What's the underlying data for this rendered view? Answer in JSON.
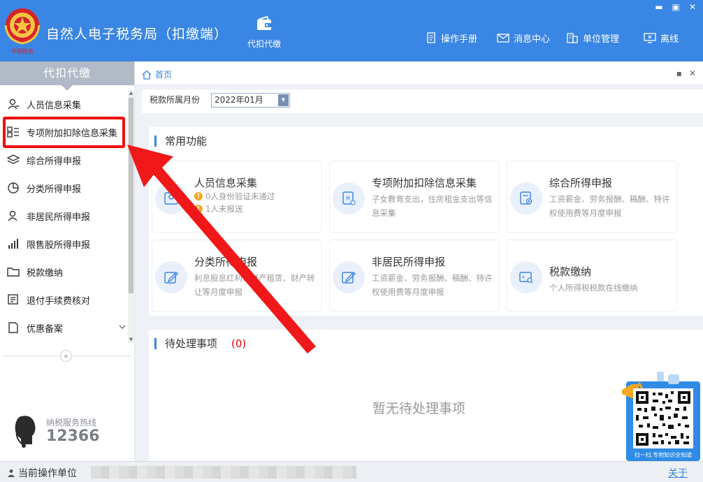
{
  "header": {
    "app_title": "自然人电子税务局（扣缴端）",
    "module_label": "代扣代缴",
    "nav": [
      {
        "label": "操作手册",
        "icon": "manual-icon"
      },
      {
        "label": "消息中心",
        "icon": "mail-icon"
      },
      {
        "label": "单位管理",
        "icon": "building-icon"
      },
      {
        "label": "离线",
        "icon": "offline-icon"
      }
    ],
    "window_controls": [
      "▬",
      "▣",
      "✕"
    ]
  },
  "sidebar": {
    "title": "代扣代缴",
    "items": [
      {
        "label": "人员信息采集",
        "icon": "person-icon"
      },
      {
        "label": "专项附加扣除信息采集",
        "icon": "list-icon"
      },
      {
        "label": "综合所得申报",
        "icon": "layers-icon"
      },
      {
        "label": "分类所得申报",
        "icon": "pie-icon"
      },
      {
        "label": "非居民所得申报",
        "icon": "person-alt-icon"
      },
      {
        "label": "限售股所得申报",
        "icon": "bar-chart-icon"
      },
      {
        "label": "税款缴纳",
        "icon": "folder-icon"
      },
      {
        "label": "退付手续费核对",
        "icon": "document-icon"
      },
      {
        "label": "优惠备案",
        "icon": "file-icon"
      }
    ],
    "hotline_label": "纳税服务热线",
    "hotline_number": "12366",
    "collapse_symbol": "«"
  },
  "tabs": {
    "home_label": "首页",
    "controls": [
      "▪",
      "✕"
    ]
  },
  "filter": {
    "label": "税款所属月份",
    "month_value": "2022年01月"
  },
  "common": {
    "title": "常用功能",
    "cards": [
      {
        "title": "人员信息采集",
        "warnings": [
          "0人身份验证未通过",
          "1人未报送"
        ],
        "desc": ""
      },
      {
        "title": "专项附加扣除信息采集",
        "warnings": [],
        "desc": "子女教育支出，住房租金支出等信息采集"
      },
      {
        "title": "综合所得申报",
        "warnings": [],
        "desc": "工资薪金、劳务报酬、稿酬、特许权使用费等月度申报"
      },
      {
        "title": "分类所得申报",
        "warnings": [],
        "desc": "利息股息红利、财产租赁、财产转让等月度申报"
      },
      {
        "title": "非居民所得申报",
        "warnings": [],
        "desc": "工资薪金、劳务报酬、稿酬、特许权使用费等月度申报"
      },
      {
        "title": "税款缴纳",
        "warnings": [],
        "desc": "个人所得税税款在线缴纳"
      }
    ]
  },
  "pending": {
    "title": "待处理事项",
    "count": "(0)",
    "empty_text": "暂无待处理事项"
  },
  "qr_widget": {
    "caption": "扫一扫,专附知识全知道"
  },
  "status": {
    "label": "当前操作单位",
    "about": "关于"
  }
}
